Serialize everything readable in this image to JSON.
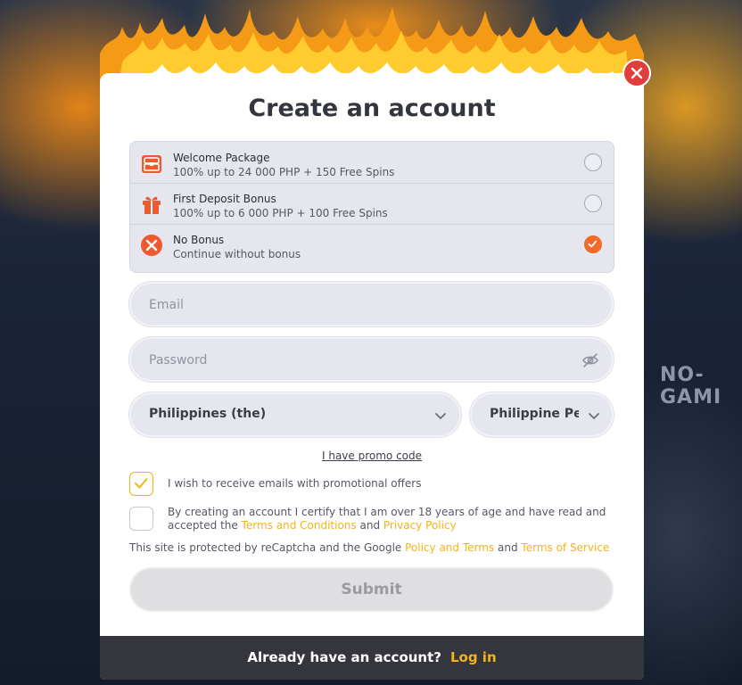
{
  "modal": {
    "title": "Create an account"
  },
  "bonuses": [
    {
      "title": "Welcome Package",
      "subtitle": "100% up to 24 000 PHP + 150 Free Spins",
      "icon": "treasure-chest-icon",
      "selected": false
    },
    {
      "title": "First Deposit Bonus",
      "subtitle": "100% up to 6 000 PHP + 100 Free Spins",
      "icon": "gift-icon",
      "selected": false
    },
    {
      "title": "No Bonus",
      "subtitle": "Continue without bonus",
      "icon": "no-bonus-x-icon",
      "selected": true
    }
  ],
  "form": {
    "email_placeholder": "Email",
    "password_placeholder": "Password",
    "country": "Philippines (the)",
    "currency": "Philippine Peso",
    "promo_link": "I have promo code",
    "promo_checkbox_label": "I wish to receive emails with promotional offers",
    "promo_checked": true,
    "terms_text_1": "By creating an account I certify that I am over 18 years of age and have read and accepted the",
    "terms_link": "Terms and Conditions",
    "terms_and": "and",
    "privacy_link": "Privacy Policy",
    "terms_checked": false,
    "recaptcha_text": "This site is protected by reCaptcha and the Google",
    "recaptcha_policy_link": "Policy and Terms",
    "recaptcha_and": "and",
    "recaptcha_tos_link": "Terms of Service",
    "submit_label": "Submit"
  },
  "footer": {
    "prompt": "Already have an account?",
    "login_label": "Log in"
  },
  "colors": {
    "accent_orange": "#f06a2a",
    "link_yellow": "#f3b31b",
    "close_red": "#e23d3d",
    "footer_bg": "#34353d"
  }
}
